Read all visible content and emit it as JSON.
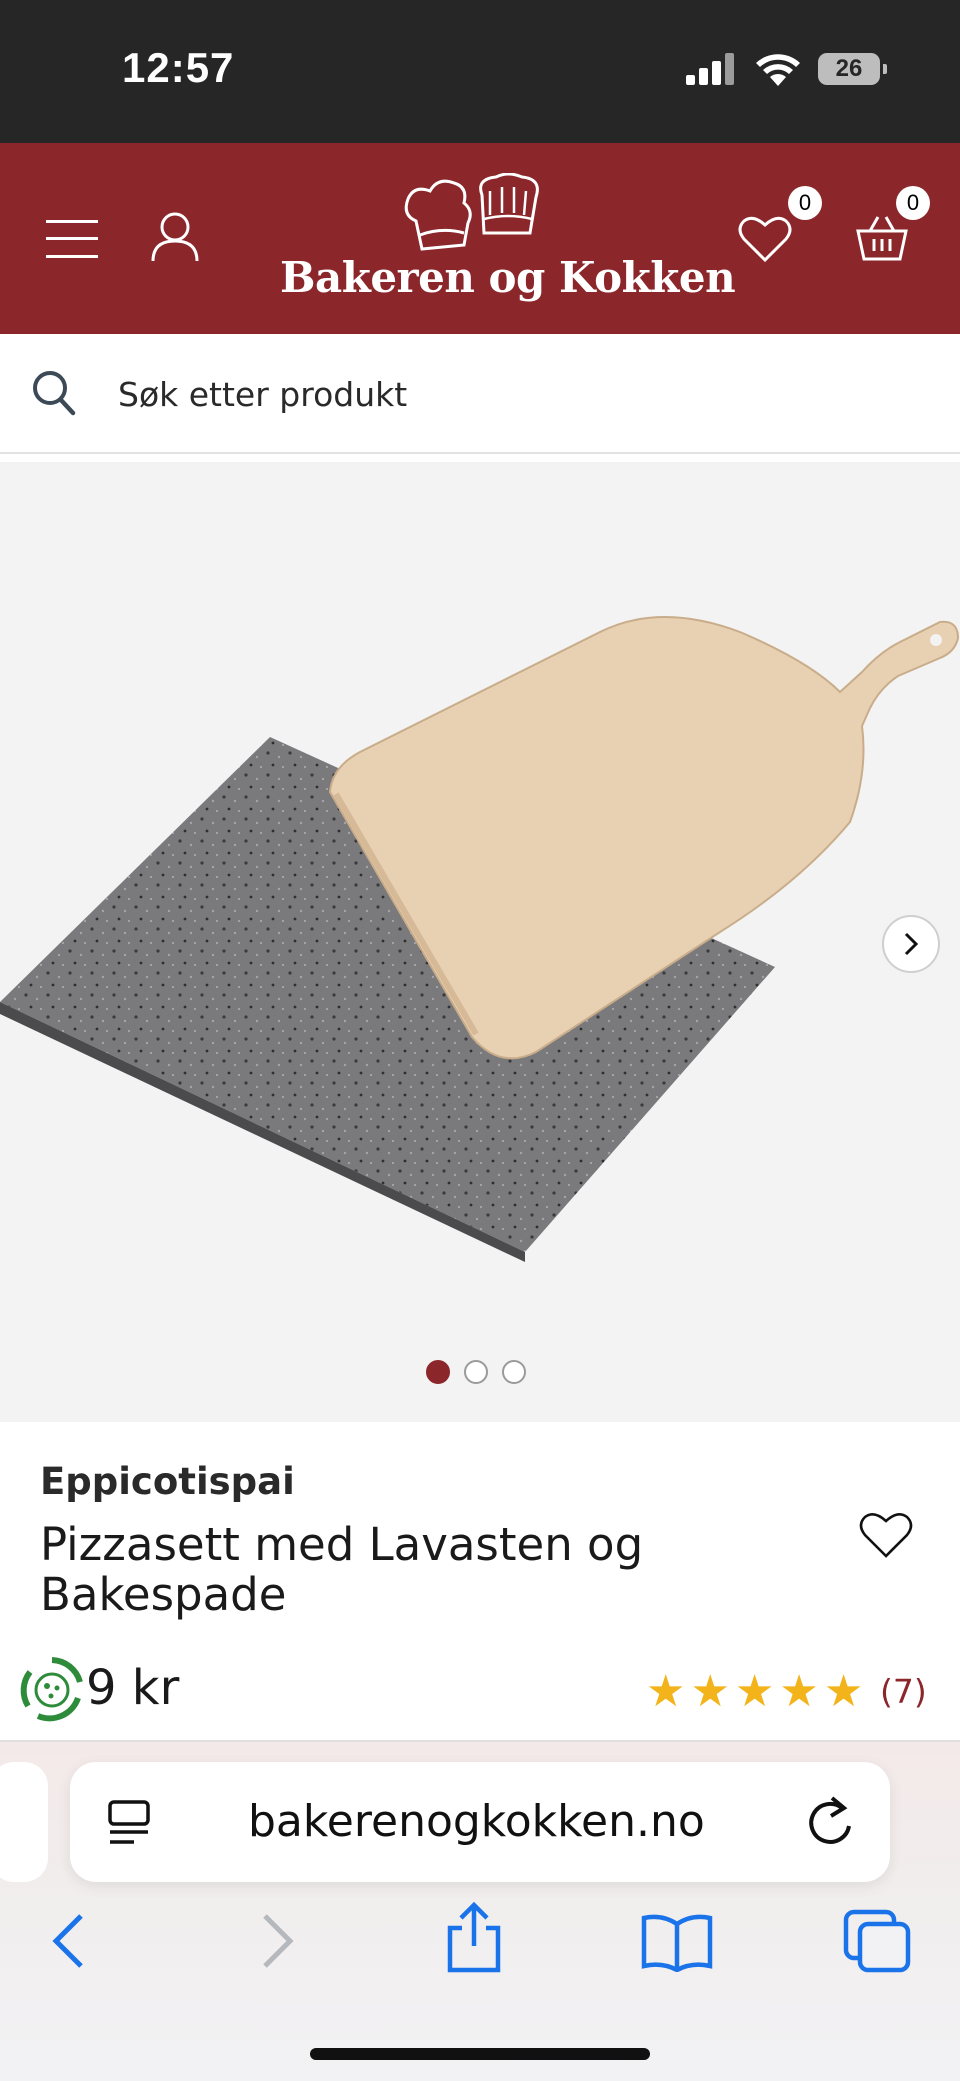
{
  "status_bar": {
    "time": "12:57",
    "battery": "26"
  },
  "header": {
    "logo_text": "Bakeren og Kokken",
    "wishlist_count": "0",
    "cart_count": "0"
  },
  "search": {
    "placeholder": "Søk etter produkt"
  },
  "gallery": {
    "total_images": 3,
    "active_index": 1
  },
  "product": {
    "brand": "Eppicotispai",
    "title": "Pizzasett med Lavasten og Bakespade",
    "price": "9 kr",
    "rating": 5,
    "review_count": "(7)"
  },
  "browser": {
    "url": "bakerenogkokken.no"
  },
  "colors": {
    "brand_red": "#8b262a",
    "star": "#f3b31a",
    "browser_blue": "#1a73e8"
  }
}
